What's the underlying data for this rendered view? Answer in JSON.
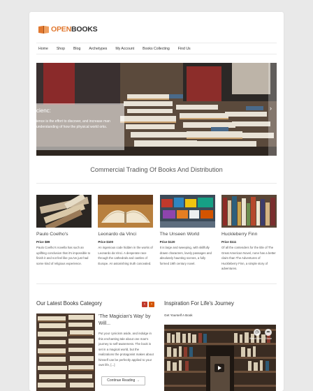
{
  "logo": {
    "open": "OPEN",
    "books": "BOOKS"
  },
  "nav": [
    "Home",
    "Shop",
    "Blog",
    "Archetypes",
    "My Account",
    "Books Collecting",
    "Find Us"
  ],
  "hero": {
    "title": "cienc:",
    "text": "ience is the effort to discover, and increase man understanding of how the physical world orks."
  },
  "section_title": "Commercial Trading Of Books And Distribution",
  "products": [
    {
      "name": "Paulo Coelho's",
      "price": "Price $89",
      "desc": "Paulo Coelho's novella has such an uplifting conclusion that it's impossible to finish it and not feel like you've just had some kind of religious experience."
    },
    {
      "name": "Leonardo da Vinci",
      "price": "Price $100",
      "desc": "An ingenious code hidden in the works of Leonardo da Vinci. A desperate race through the cathedrals and castles of Europe. An astonishing truth concealed."
    },
    {
      "name": "The Unseen World",
      "price": "Price $120",
      "desc": "It is large and sweeping, with skillfully drawn characters, lovely passages and absolutely haunting scenes, a fully formed 19th century novel."
    },
    {
      "name": "Huckleberry Finn",
      "price": "Price $111",
      "desc": "Of all the contenders for the title of The Great American Novel, none has a better claim than The Adventures of Huckleberry Finn, a simple story of adventures."
    }
  ],
  "latest": {
    "title": "Our Latest Books Category",
    "prev": "‹",
    "next": "›",
    "book_title": "'The Magician's Way' by Will...",
    "book_text": "Put your cynicism aside, and indulge in this enchanting tale about one man's journey to self-awareness. The book is set in a magical world, but the realizations the protagonist makes about himself can be perfectly applied to your own life, [...]",
    "continue": "Continue Reading →"
  },
  "inspire": {
    "title": "Inspiration For Life's Journey",
    "sub": "Get Yourself A Book",
    "controls": [
      "Watch later",
      "Share"
    ]
  }
}
